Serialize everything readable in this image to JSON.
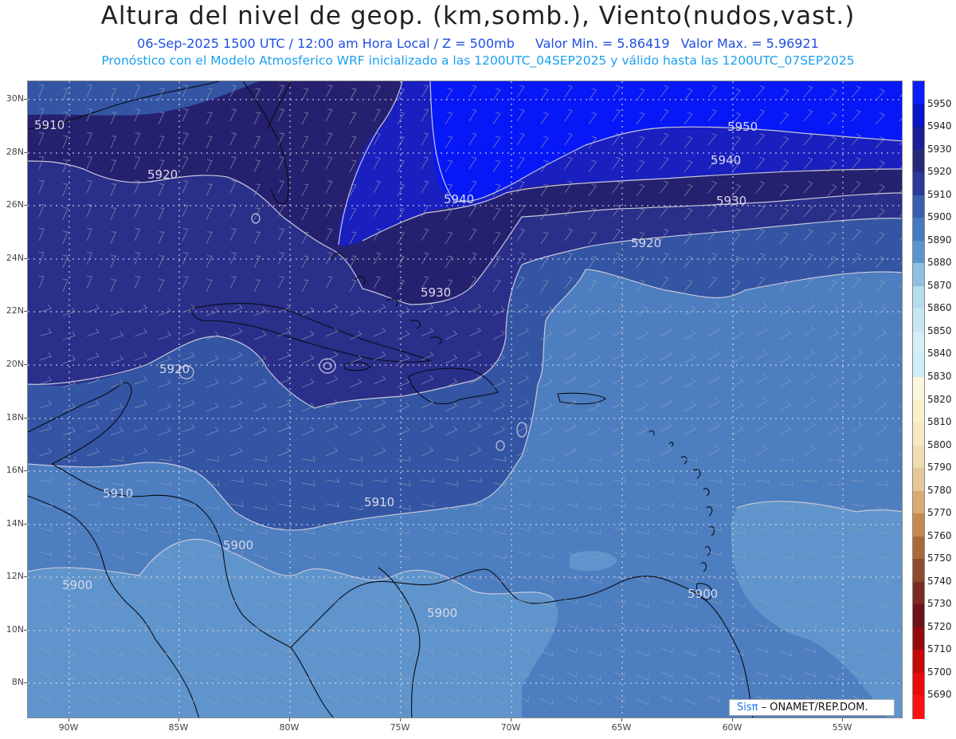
{
  "header": {
    "title": "Altura del nivel de geop. (km,somb.), Viento(nudos,vast.)",
    "datetime": "06-Sep-2025  1500 UTC / 12:00 am Hora Local / Z = 500mb",
    "min_value": "Valor Min. = 5.86419",
    "max_value": "Valor Max. = 5.96921",
    "model_info": "Pronóstico con el Modelo Atmosferico WRF inicializado a las 1200UTC_04SEP2025 y válido hasta las  1200UTC_07SEP2025"
  },
  "map": {
    "lat_labels": [
      "30N",
      "28N",
      "26N",
      "24N",
      "22N",
      "20N",
      "18N",
      "16N",
      "14N",
      "12N",
      "10N",
      "8N"
    ],
    "lon_labels": [
      "90W",
      "85W",
      "80W",
      "75W",
      "70W",
      "65W",
      "60W",
      "55W"
    ],
    "contour_labels": [
      "5910",
      "5920",
      "5940",
      "5950",
      "5940",
      "5930",
      "5920",
      "5930",
      "5920",
      "5910",
      "5910",
      "5900",
      "5900",
      "5900",
      "5900"
    ],
    "fill_colors": {
      "c5900": "#4c7ec0",
      "c5890": "#5f95cc",
      "c5910": "#3355a4",
      "c5920": "#2a2f8a",
      "c5930": "#25216f",
      "c5940": "#1a1fbf",
      "c5950": "#0718f6"
    },
    "credit_brand": "Sisπ",
    "credit_org": "– ONAMET/REP.DOM."
  },
  "colorbar": {
    "labels": [
      "5950",
      "5940",
      "5930",
      "5920",
      "5910",
      "5900",
      "5890",
      "5880",
      "5870",
      "5860",
      "5850",
      "5840",
      "5830",
      "5820",
      "5810",
      "5800",
      "5790",
      "5780",
      "5770",
      "5760",
      "5750",
      "5740",
      "5730",
      "5720",
      "5710",
      "5700",
      "5690"
    ],
    "colors": [
      "#0b1cff",
      "#0a14c8",
      "#1a1f96",
      "#262a78",
      "#2b3a9a",
      "#3a5eae",
      "#4679be",
      "#5a94cc",
      "#8fc0e2",
      "#b4dcee",
      "#c6e6f2",
      "#d6eef6",
      "#cdeef6",
      "#fbf6dc",
      "#fbf0cc",
      "#f6e8c0",
      "#efdcb0",
      "#e6c898",
      "#d8ab72",
      "#c58a50",
      "#a86a3a",
      "#8e4a2c",
      "#7a2a22",
      "#6a141a",
      "#940a10",
      "#c40808",
      "#ea0a0a",
      "#ff1010"
    ]
  }
}
